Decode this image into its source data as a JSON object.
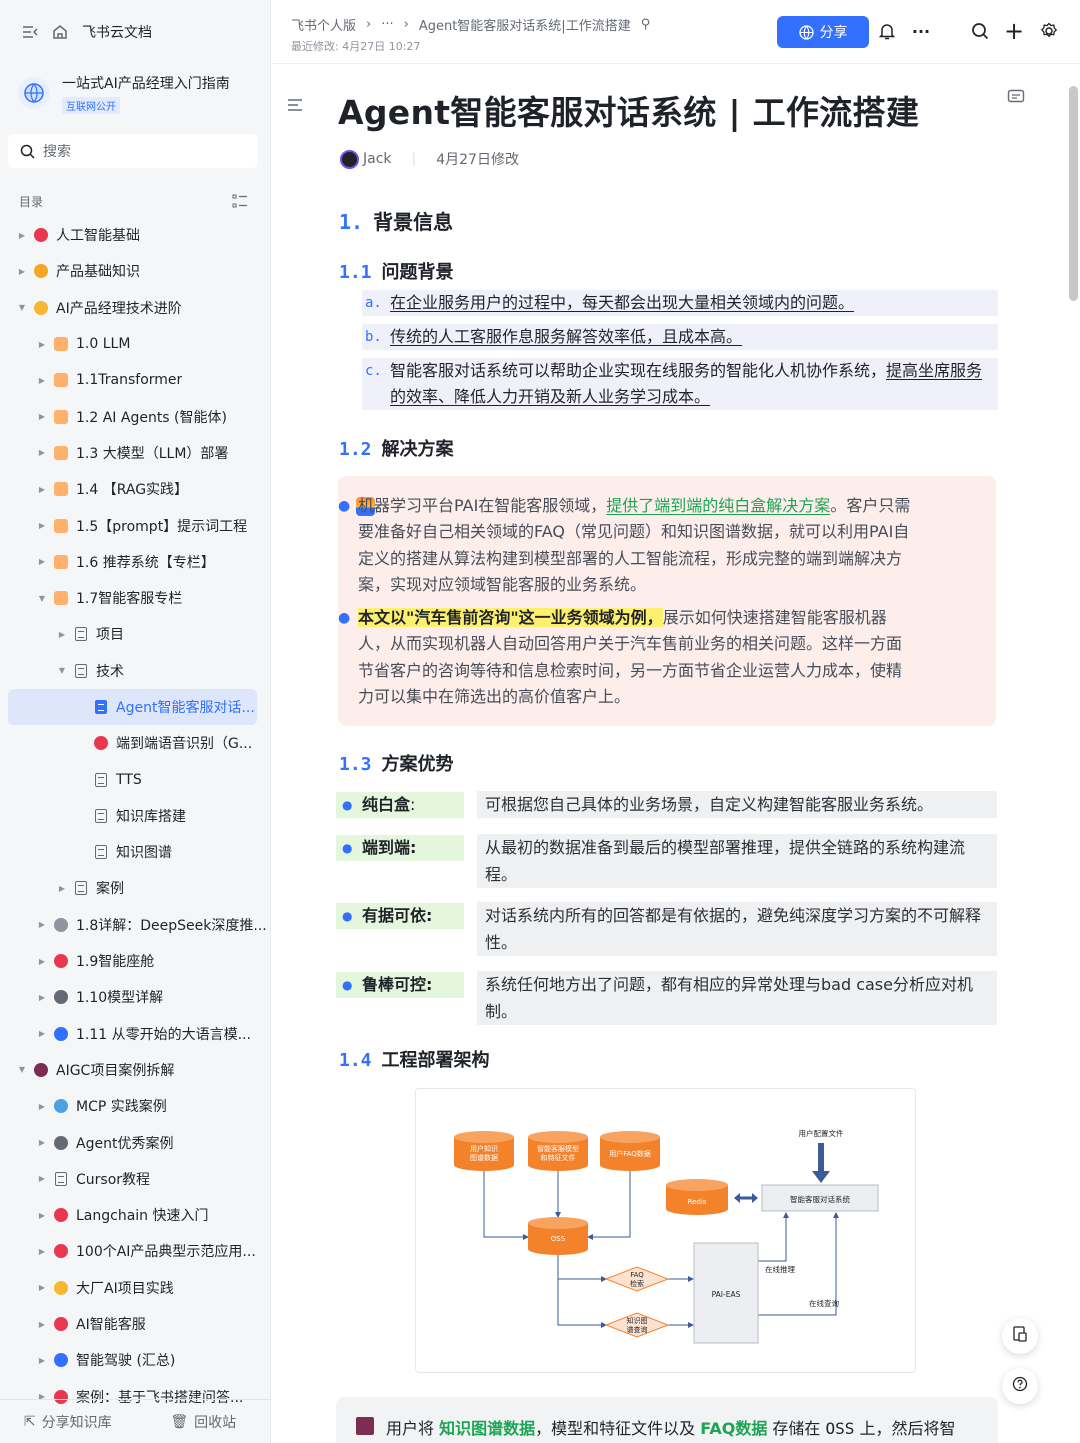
{
  "sidebar": {
    "app_title": "飞书云文档",
    "space": {
      "name": "一站式AI产品经理入门指南",
      "tag": "互联网公开"
    },
    "search_placeholder": "搜索",
    "toc_label": "目录",
    "items": [
      {
        "label": "人工智能基础",
        "depth": 0,
        "arrow": "▶",
        "icon": "emoji-face",
        "color": "#e8384f"
      },
      {
        "label": "产品基础知识",
        "depth": 0,
        "arrow": "▶",
        "icon": "swirl-icon",
        "color": "#f5a623"
      },
      {
        "label": "AI产品经理技术进阶",
        "depth": 0,
        "arrow": "▼",
        "icon": "folder-icon",
        "color": "#f7b733"
      },
      {
        "label": "1.0 LLM",
        "depth": 1,
        "arrow": "▶",
        "icon": "square-icon",
        "color": "#ffb06b"
      },
      {
        "label": "1.1Transformer",
        "depth": 1,
        "arrow": "▶",
        "icon": "square-icon",
        "color": "#ffb06b"
      },
      {
        "label": "1.2 AI Agents (智能体)",
        "depth": 1,
        "arrow": "▶",
        "icon": "square-icon",
        "color": "#ffb06b"
      },
      {
        "label": "1.3 大模型（LLM）部署",
        "depth": 1,
        "arrow": "▶",
        "icon": "square-icon",
        "color": "#ffb06b"
      },
      {
        "label": "1.4 【RAG实践】",
        "depth": 1,
        "arrow": "▶",
        "icon": "square-icon",
        "color": "#ffb06b"
      },
      {
        "label": "1.5【prompt】提示词工程",
        "depth": 1,
        "arrow": "▶",
        "icon": "square-icon",
        "color": "#ffb06b"
      },
      {
        "label": "1.6 推荐系统【专栏】",
        "depth": 1,
        "arrow": "▶",
        "icon": "square-icon",
        "color": "#ffb06b"
      },
      {
        "label": "1.7智能客服专栏",
        "depth": 1,
        "arrow": "▼",
        "icon": "square-icon",
        "color": "#ffb06b"
      },
      {
        "label": "项目",
        "depth": 2,
        "arrow": "▶",
        "icon": "doc-icon"
      },
      {
        "label": "技术",
        "depth": 2,
        "arrow": "▼",
        "icon": "doc-icon"
      },
      {
        "label": "Agent智能客服对话...",
        "depth": 3,
        "arrow": "",
        "icon": "doc-blue-icon",
        "active": true
      },
      {
        "label": "端到端语音识别（G...",
        "depth": 3,
        "arrow": "",
        "icon": "pin-icon",
        "color": "#e8384f"
      },
      {
        "label": "TTS",
        "depth": 3,
        "arrow": "",
        "icon": "doc-icon"
      },
      {
        "label": "知识库搭建",
        "depth": 3,
        "arrow": "",
        "icon": "doc-icon"
      },
      {
        "label": "知识图谱",
        "depth": 3,
        "arrow": "",
        "icon": "doc-icon"
      },
      {
        "label": "案例",
        "depth": 2,
        "arrow": "▶",
        "icon": "doc-icon"
      },
      {
        "label": "1.8详解：DeepSeek深度推...",
        "depth": 1,
        "arrow": "▶",
        "icon": "gear-icon",
        "color": "#8f959e"
      },
      {
        "label": "1.9智能座舱",
        "depth": 1,
        "arrow": "▶",
        "icon": "car-icon",
        "color": "#e8384f"
      },
      {
        "label": "1.10模型详解",
        "depth": 1,
        "arrow": "▶",
        "icon": "tools-icon",
        "color": "#646a73"
      },
      {
        "label": "1.11 从零开始的大语言模...",
        "depth": 1,
        "arrow": "▶",
        "icon": "rocket-icon",
        "color": "#3370ff"
      },
      {
        "label": "AIGC项目案例拆解",
        "depth": 0,
        "arrow": "▼",
        "icon": "save-icon",
        "color": "#7b2d52"
      },
      {
        "label": "MCP 实践案例",
        "depth": 1,
        "arrow": "▶",
        "icon": "ufo-icon",
        "color": "#4aa3df"
      },
      {
        "label": "Agent优秀案例",
        "depth": 1,
        "arrow": "▶",
        "icon": "robot-icon",
        "color": "#646a73"
      },
      {
        "label": "Cursor教程",
        "depth": 1,
        "arrow": "▶",
        "icon": "doc-icon"
      },
      {
        "label": "Langchain 快速入门",
        "depth": 1,
        "arrow": "▶",
        "icon": "image-icon",
        "color": "#e8384f"
      },
      {
        "label": "100个AI产品典型示范应用...",
        "depth": 1,
        "arrow": "▶",
        "icon": "hundred-icon",
        "color": "#e8384f"
      },
      {
        "label": "大厂AI项目实践",
        "depth": 1,
        "arrow": "▶",
        "icon": "medal-icon",
        "color": "#f7b733"
      },
      {
        "label": "AI智能客服",
        "depth": 1,
        "arrow": "▶",
        "icon": "phone-icon",
        "color": "#e8384f"
      },
      {
        "label": "智能驾驶  (汇总)",
        "depth": 1,
        "arrow": "▶",
        "icon": "car-icon",
        "color": "#3370ff"
      },
      {
        "label": "案例：基于飞书搭建问答...",
        "depth": 1,
        "arrow": "▶",
        "icon": "bug-icon",
        "color": "#e8384f"
      }
    ],
    "bottom": {
      "share": "分享知识库",
      "trash": "回收站"
    }
  },
  "topbar": {
    "breadcrumb": [
      "飞书个人版",
      "···",
      "Agent智能客服对话系统|工作流搭建"
    ],
    "modified": "最近修改: 4月27日 10:27",
    "share_label": "分享"
  },
  "doc": {
    "title": "Agent智能客服对话系统 | 工作流搭建",
    "author": "Jack",
    "modified": "4月27日修改",
    "s1": {
      "num": "1.",
      "title": "背景信息"
    },
    "s11": {
      "num": "1.1",
      "title": "问题背景"
    },
    "s11_items": [
      {
        "mk": "a.",
        "text": "在企业服务用户的过程中，每天都会出现大量相关领域内的问题。"
      },
      {
        "mk": "b.",
        "text": "传统的人工客服作息服务解答效率低，且成本高。"
      },
      {
        "mk": "c.",
        "text_plain": "智能客服对话系统可以帮助企业实现在线服务的智能化人机协作系统，",
        "text_ul": "提高坐席服务的效率、降低人力开销及新人业务学习成本。"
      }
    ],
    "s12": {
      "num": "1.2",
      "title": "解决方案"
    },
    "callout": {
      "p1_a": "机器学习平台PAI在智能客服领域，",
      "p1_link": "提供了端到端的纯白盒解决方案",
      "p1_b": "。客户只需要准备好自己相关领域的FAQ（常见问题）和知识图谱数据，就可以利用PAI自定义的搭建从算法构建到模型部署的人工智能流程，形成完整的端到端解决方案，实现对应领域智能客服的业务系统。",
      "p2_hl": "本文以\"汽车售前咨询\"这一业务领域为例，",
      "p2_b": "展示如何快速搭建智能客服机器人，从而实现机器人自动回答用户关于汽车售前业务的相关问题。这样一方面节省客户的咨询等待和信息检索时间，另一方面节省企业运营人力成本，使精力可以集中在筛选出的高价值客户上。"
    },
    "s13": {
      "num": "1.3",
      "title": "方案优势"
    },
    "advantages": [
      {
        "key": "纯白盒",
        "colon": ":",
        "value": "可根据您自己具体的业务场景，自定义构建智能客服业务系统。"
      },
      {
        "key": "端到端",
        "colon": ":",
        "value": "从最初的数据准备到最后的模型部署推理，提供全链路的系统构建流程。"
      },
      {
        "key": "有据可依",
        "colon": ":",
        "value": "对话系统内所有的回答都是有依据的，避免纯深度学习方案的不可解释性。"
      },
      {
        "key": "鲁棒可控",
        "colon": ":",
        "value": "系统任何地方出了问题，都有相应的异常处理与bad case分析应对机制。"
      }
    ],
    "s14": {
      "num": "1.4",
      "title": "工程部署架构"
    },
    "diagram": {
      "db1": "用户知识图谱数据",
      "db2": "智能客服模型和特征文件",
      "db3": "用户FAQ数据",
      "redis": "Redis",
      "oss": "OSS",
      "config": "用户配置文件",
      "system": "智能客服对话系统",
      "faq": "FAQ检索",
      "kg": "知识图谱查询",
      "eas": "PAI-EAS",
      "online_infer": "在线推理",
      "online_query": "在线查询"
    },
    "bottom_note": {
      "a": "用户将",
      "b": "知识图谱数据",
      "c": "，模型和特征文件以及",
      "d": "FAQ数据",
      "e": "存储在",
      "f": "OSS",
      "g": "上，然后将智"
    }
  }
}
